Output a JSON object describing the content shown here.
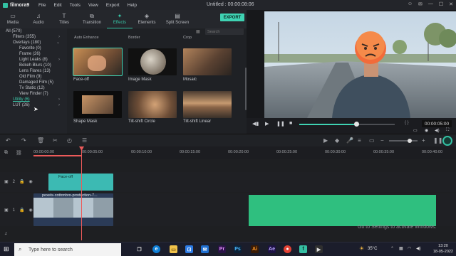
{
  "app": {
    "name": "filmora9",
    "menu": [
      "File",
      "Edit",
      "Tools",
      "View",
      "Export",
      "Help"
    ],
    "title": "Untitled : 00:00:08:06"
  },
  "tabs": [
    {
      "label": "Media",
      "icon": "folder-icon"
    },
    {
      "label": "Audio",
      "icon": "music-note-icon"
    },
    {
      "label": "Titles",
      "icon": "text-icon"
    },
    {
      "label": "Transition",
      "icon": "transition-icon"
    },
    {
      "label": "Effects",
      "icon": "effects-icon",
      "active": true
    },
    {
      "label": "Elements",
      "icon": "elements-icon"
    },
    {
      "label": "Split Screen",
      "icon": "split-screen-icon"
    }
  ],
  "export_label": "EXPORT",
  "tree": [
    {
      "label": "All (570)",
      "indent": 0
    },
    {
      "label": "Filters (355)",
      "indent": 1,
      "arrow": "›"
    },
    {
      "label": "Overlays (180)",
      "indent": 1,
      "arrow": "⌄"
    },
    {
      "label": "Favorite (0)",
      "indent": 2
    },
    {
      "label": "Frame (26)",
      "indent": 2
    },
    {
      "label": "Light Leaks (8)",
      "indent": 2,
      "arrow": "›"
    },
    {
      "label": "Bokeh Blurs (10)",
      "indent": 2
    },
    {
      "label": "Lens Flares (13)",
      "indent": 2
    },
    {
      "label": "Old Film (9)",
      "indent": 2
    },
    {
      "label": "Damaged Film (5)",
      "indent": 2
    },
    {
      "label": "Tv Static (12)",
      "indent": 2
    },
    {
      "label": "View Finder (7)",
      "indent": 2
    },
    {
      "label": "Utility (6)",
      "indent": 1,
      "active": true,
      "arrow": "›"
    },
    {
      "label": "LUT (26)",
      "indent": 1,
      "arrow": "›"
    }
  ],
  "effects": {
    "search_placeholder": "Search",
    "cut_labels": [
      "Auto Enhance",
      "Border",
      "Crop"
    ],
    "items": [
      {
        "label": "Face-off",
        "selected": true
      },
      {
        "label": "Image Mask"
      },
      {
        "label": "Mosaic"
      },
      {
        "label": "Shape Mask"
      },
      {
        "label": "Tilt-shift Circle"
      },
      {
        "label": "Tilt-shift Linear"
      }
    ]
  },
  "preview": {
    "timecode": "00:00:05:00",
    "progress": 0.6,
    "brackets": "{  }"
  },
  "timeline": {
    "ruler": [
      "00:00:00:00",
      "00:00:05:00",
      "00:00:10:00",
      "00:00:15:00",
      "00:00:20:00",
      "00:00:25:00",
      "00:00:30:00",
      "00:00:35:00",
      "00:00:40:00"
    ],
    "tracks": [
      {
        "num": "2",
        "clip_label": "Face-off"
      },
      {
        "num": "1",
        "clip_label": "pexels-cottonbro-production-7..."
      }
    ]
  },
  "watermark": "Go to Settings to activate Windows.",
  "taskbar": {
    "search_placeholder": "Type here to search",
    "weather": "35°C",
    "time": "13:20",
    "date": "18-05-2022"
  }
}
